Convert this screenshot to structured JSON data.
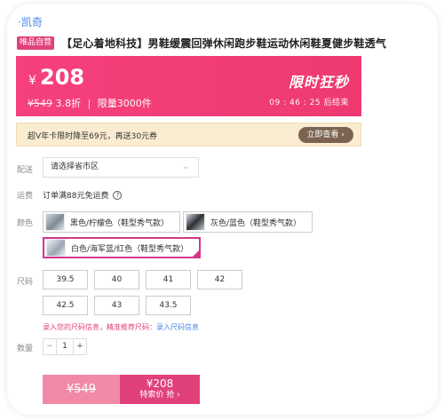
{
  "brand": {
    "link_text": "·凯奇"
  },
  "product": {
    "tag": "唯品自营",
    "title": "【足心着地科技】男鞋缓震回弹休闲跑步鞋运动休闲鞋夏健步鞋透气"
  },
  "flash_sale": {
    "currency": "¥",
    "price": "208",
    "original_price": "¥549",
    "discount": "3.8折",
    "limit": "限量3000件",
    "badge": "限时狂秒",
    "countdown": "09 : 46 : 25 后结束",
    "colors": {
      "start": "#f6407c",
      "end": "#ee3a71"
    }
  },
  "vip_banner": {
    "text": "超V年卡限时降至69元，再送30元券",
    "button": "立即查看 ›"
  },
  "delivery": {
    "label": "配送",
    "placeholder": "请选择省市区",
    "chevron_icon": "chevron-down-icon"
  },
  "shipping": {
    "label": "运费",
    "text": "订单满88元免运费"
  },
  "colors": {
    "label": "颜色",
    "options": [
      {
        "label": "黑色/柠檬色（鞋型秀气款）",
        "selected": false
      },
      {
        "label": "灰色/蓝色（鞋型秀气款）",
        "selected": false
      },
      {
        "label": "白色/海军蓝/红色（鞋型秀气款）",
        "selected": true
      }
    ]
  },
  "sizes": {
    "label": "尺码",
    "options": [
      "39.5",
      "40",
      "41",
      "42",
      "42.5",
      "43",
      "43.5"
    ],
    "hint": "录入您的尺码信息，精准推荐尺码：",
    "hint_link": "录入尺码信息"
  },
  "quantity": {
    "label": "数量",
    "minus": "−",
    "value": "1",
    "plus": "+"
  },
  "purchase": {
    "original_price": "¥549",
    "special_price": "¥208",
    "special_label": "特索价 抢 ›"
  }
}
